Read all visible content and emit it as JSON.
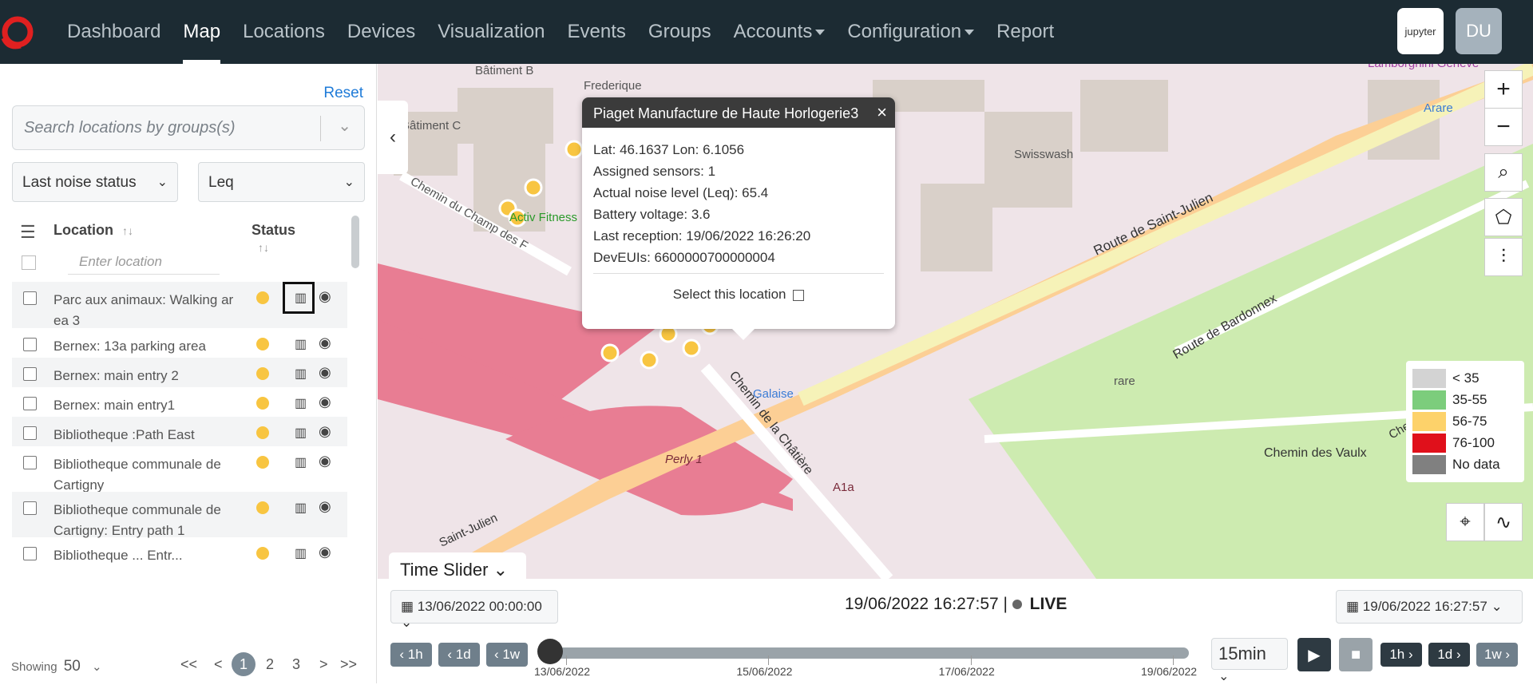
{
  "nav": {
    "items": [
      {
        "label": "Dashboard",
        "active": false,
        "caret": false
      },
      {
        "label": "Map",
        "active": true,
        "caret": false
      },
      {
        "label": "Locations",
        "active": false,
        "caret": false
      },
      {
        "label": "Devices",
        "active": false,
        "caret": false
      },
      {
        "label": "Visualization",
        "active": false,
        "caret": false
      },
      {
        "label": "Events",
        "active": false,
        "caret": false
      },
      {
        "label": "Groups",
        "active": false,
        "caret": false
      },
      {
        "label": "Accounts",
        "active": false,
        "caret": true
      },
      {
        "label": "Configuration",
        "active": false,
        "caret": true
      },
      {
        "label": "Report",
        "active": false,
        "caret": false
      }
    ],
    "jupyter_label": "jupyter",
    "avatar_initials": "DU"
  },
  "sidebar": {
    "reset_label": "Reset",
    "search_placeholder": "Search locations by groups(s)",
    "status_select": "Last noise status",
    "metric_select": "Leq",
    "col_location": "Location",
    "col_status": "Status",
    "location_filter_placeholder": "Enter location",
    "rows": [
      {
        "name": "Parc aux animaux: Walking ar ea 3",
        "status_color": "#f8c541"
      },
      {
        "name": "Bernex: 13a parking area",
        "status_color": "#f8c541"
      },
      {
        "name": "Bernex: main entry 2",
        "status_color": "#f8c541"
      },
      {
        "name": "Bernex: main entry1",
        "status_color": "#f8c541"
      },
      {
        "name": "Bibliotheque :Path East",
        "status_color": "#f8c541"
      },
      {
        "name": "Bibliotheque communale de Cartigny",
        "status_color": "#f8c541"
      },
      {
        "name": "Bibliotheque communale de Cartigny: Entry path 1",
        "status_color": "#f8c541"
      },
      {
        "name": "Bibliotheque ... Entr...",
        "status_color": "#f8c541"
      }
    ],
    "showing_label": "Showing",
    "page_size": "50",
    "pager": {
      "first": "<<",
      "prev": "<",
      "pages": [
        "1",
        "2",
        "3"
      ],
      "active_page": "1",
      "next": ">",
      "last": ">>"
    }
  },
  "popup": {
    "title": "Piaget Manufacture de Haute Horlogerie3",
    "close": "×",
    "lat_lon": "Lat: 46.1637   Lon: 6.1056",
    "assigned": "Assigned sensors: 1",
    "noise": "Actual noise level (Leq): 65.4",
    "battery": "Battery voltage: 3.6",
    "reception": "Last reception: 19/06/2022 16:26:20",
    "deveuis": "DevEUIs: 6600000700000004",
    "select_label": "Select this location"
  },
  "map": {
    "labels": [
      "Bâtiment B",
      "Frederique",
      "Bâtiment C",
      "Swisswash",
      "Activ Fitness",
      "Chemin du Champ des F",
      "Route de Saint-Julien",
      "Route de Bardonnex",
      "Chemin des Vaulx",
      "Chemin de la Châtière",
      "Galaise",
      "Perly 1",
      "A1a",
      "Saint-Julien",
      "Lamborghini Genève",
      "Arare",
      "rare",
      "Chemin de Tr"
    ],
    "zoom_in": "+",
    "zoom_out": "−"
  },
  "legend": [
    {
      "label": "< 35",
      "color": "#d3d3d3"
    },
    {
      "label": "35-55",
      "color": "#7ccd7c"
    },
    {
      "label": "56-75",
      "color": "#fdd26a"
    },
    {
      "label": "76-100",
      "color": "#e0101b"
    },
    {
      "label": "No data",
      "color": "#808080"
    }
  ],
  "timebar": {
    "tab_label": "Time Slider",
    "start_date": "13/06/2022 00:00:00",
    "end_date": "19/06/2022 16:27:57",
    "current": "19/06/2022 16:27:57 |",
    "live": "LIVE",
    "back_buttons": [
      "1h",
      "1d",
      "1w"
    ],
    "fwd_buttons": [
      "1h",
      "1d",
      "1w"
    ],
    "interval": "15min",
    "ticks": [
      "13/06/2022",
      "15/06/2022",
      "17/06/2022",
      "19/06/2022"
    ],
    "slider_position": 0.0
  }
}
